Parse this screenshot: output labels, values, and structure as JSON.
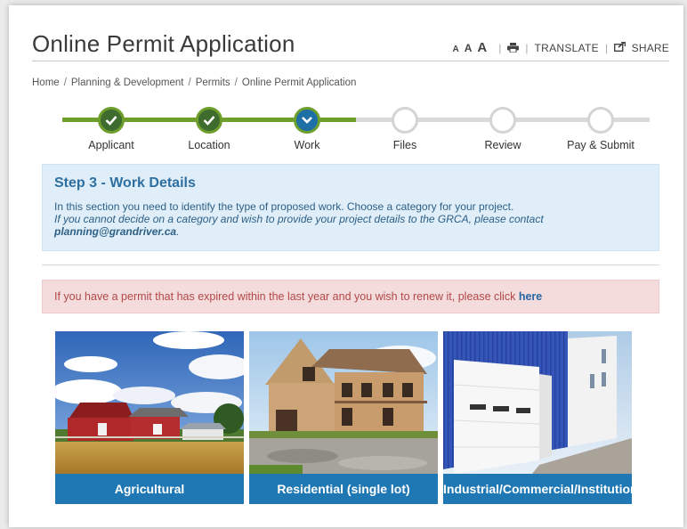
{
  "page": {
    "title": "Online Permit Application"
  },
  "tools": {
    "text_small": "A",
    "text_medium": "A",
    "text_large": "A",
    "print_icon": "print-icon",
    "translate": "TRANSLATE",
    "share": "SHARE",
    "share_icon": "share-icon"
  },
  "breadcrumb": {
    "items": [
      "Home",
      "Planning & Development",
      "Permits",
      "Online Permit Application"
    ],
    "separator": "/"
  },
  "steps": {
    "items": [
      {
        "label": "Applicant",
        "state": "done"
      },
      {
        "label": "Location",
        "state": "done"
      },
      {
        "label": "Work",
        "state": "current"
      },
      {
        "label": "Files",
        "state": "todo"
      },
      {
        "label": "Review",
        "state": "todo"
      },
      {
        "label": "Pay & Submit",
        "state": "todo"
      }
    ],
    "colors": {
      "done_line": "#6e9e2c",
      "todo_line": "#d9d9d9",
      "done_fill": "#3e6b2e",
      "current_fill": "#1d6fa6"
    }
  },
  "info": {
    "title": "Step 3 - Work Details",
    "line1": "In this section you need to identify the type of proposed work. Choose a category for your project.",
    "line2": "If you cannot decide on a category and wish to provide your project details to the GRCA, please contact",
    "email": "planning@grandriver.ca",
    "email_suffix": "."
  },
  "alert": {
    "text": "If you have a permit that has expired within the last year and you wish to renew it, please click",
    "link": "here"
  },
  "categories": [
    {
      "label": "Agricultural"
    },
    {
      "label": "Residential (single lot)"
    },
    {
      "label": "Industrial/Commercial/Institutional"
    }
  ],
  "colors": {
    "brand_blue": "#1f78b3",
    "alert_bg": "#f4dcdc",
    "info_bg": "#dfeef8"
  }
}
